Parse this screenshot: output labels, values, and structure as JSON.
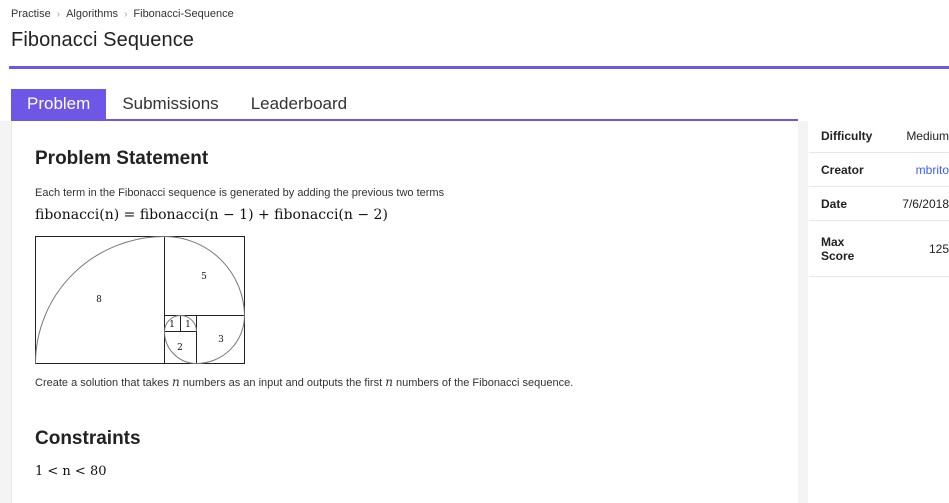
{
  "breadcrumb": {
    "items": [
      "Practise",
      "Algorithms",
      "Fibonacci-Sequence"
    ]
  },
  "page": {
    "title": "Fibonacci Sequence"
  },
  "tabs": [
    {
      "label": "Problem",
      "active": true
    },
    {
      "label": "Submissions",
      "active": false
    },
    {
      "label": "Leaderboard",
      "active": false
    }
  ],
  "problem": {
    "statement_heading": "Problem Statement",
    "description": "Each term in the Fibonacci sequence is generated by adding the previous two terms",
    "formula": "fibonacci(n) = fibonacci(n − 1) + fibonacci(n − 2)",
    "figure_labels": [
      "8",
      "5",
      "3",
      "2",
      "1",
      "1"
    ],
    "solution_pre": "Create a solution that takes",
    "solution_var": "n",
    "solution_mid": "numbers as an input and outputs the first",
    "solution_var2": "n",
    "solution_post": "numbers of the Fibonacci sequence.",
    "constraints_heading": "Constraints",
    "constraint": "1 < n < 80"
  },
  "meta": [
    {
      "key": "Difficulty",
      "value": "Medium"
    },
    {
      "key": "Creator",
      "value": "mbrito"
    },
    {
      "key": "Date",
      "value": "7/6/2018"
    },
    {
      "key": "Max Score",
      "value": "125"
    }
  ],
  "colors": {
    "accent": "#6e56e6",
    "link": "#3d5afe"
  }
}
